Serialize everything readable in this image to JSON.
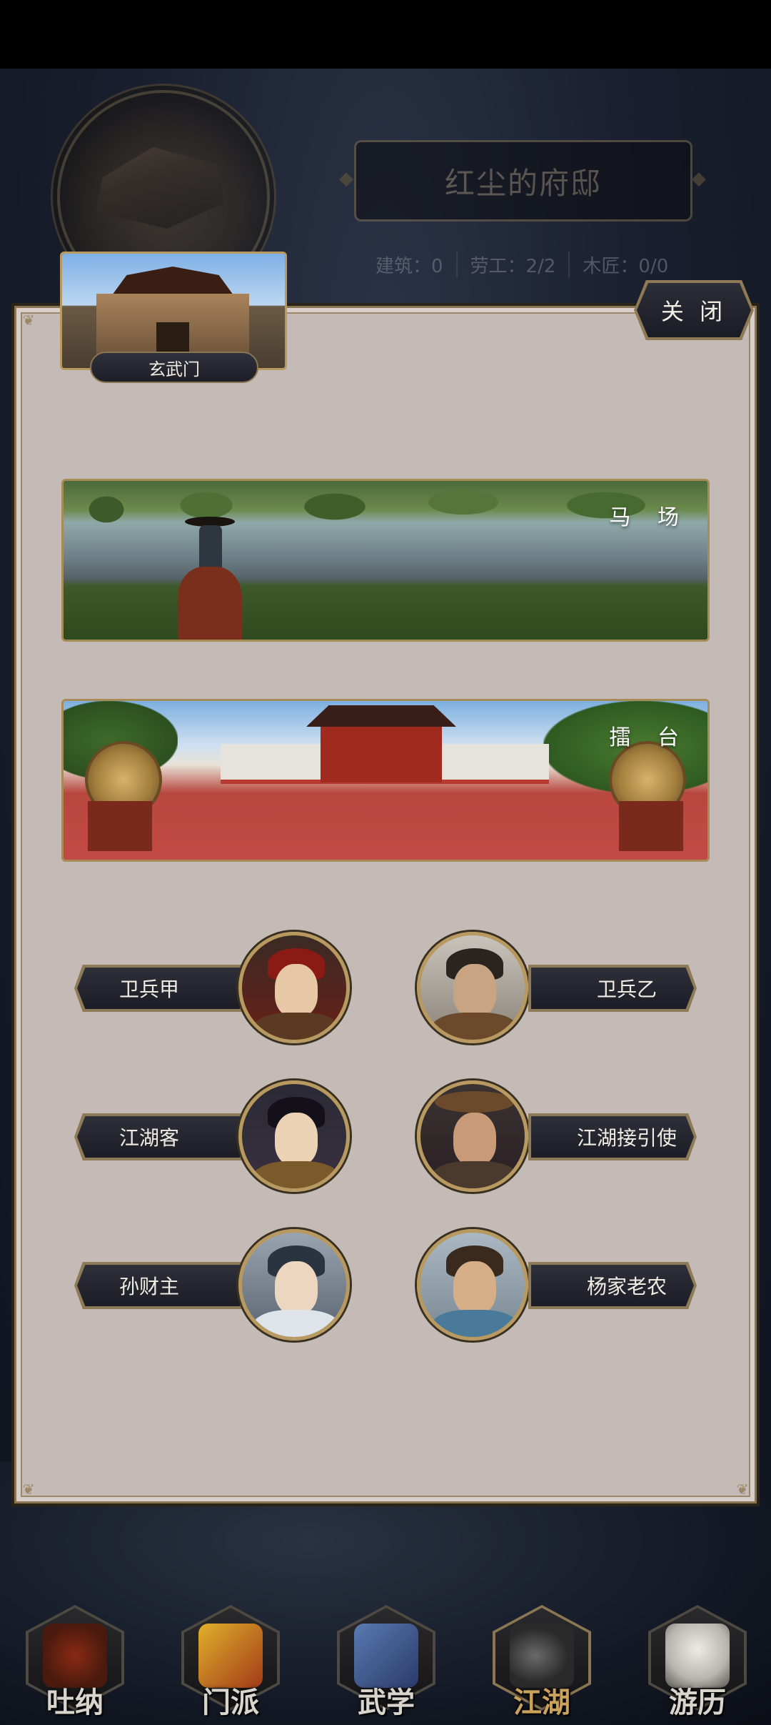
{
  "residence": {
    "title": "红尘的府邸",
    "stats": [
      "建筑：0",
      "劳工：2/2",
      "木匠：0/0"
    ]
  },
  "panel": {
    "close_label": "关 闭",
    "gate_label": "玄武门",
    "banners": [
      {
        "title": "马 场"
      },
      {
        "title": "擂 台"
      }
    ],
    "npcs": [
      {
        "name": "卫兵甲"
      },
      {
        "name": "卫兵乙"
      },
      {
        "name": "江湖客"
      },
      {
        "name": "江湖接引使"
      },
      {
        "name": "孙财主"
      },
      {
        "name": "杨家老农"
      }
    ]
  },
  "nav": {
    "items": [
      {
        "label": "吐纳",
        "icon": "meditation-icon"
      },
      {
        "label": "门派",
        "icon": "sect-flag-icon"
      },
      {
        "label": "武学",
        "icon": "martial-books-icon"
      },
      {
        "label": "江湖",
        "icon": "jianghu-hat-icon",
        "active": true
      },
      {
        "label": "游历",
        "icon": "horse-travel-icon"
      }
    ]
  },
  "colors": {
    "panel_bg": "#c5bbb6",
    "gold_border": "#b89a60",
    "plate_dark": "#1b1c24",
    "active_nav": "#caa25c"
  }
}
